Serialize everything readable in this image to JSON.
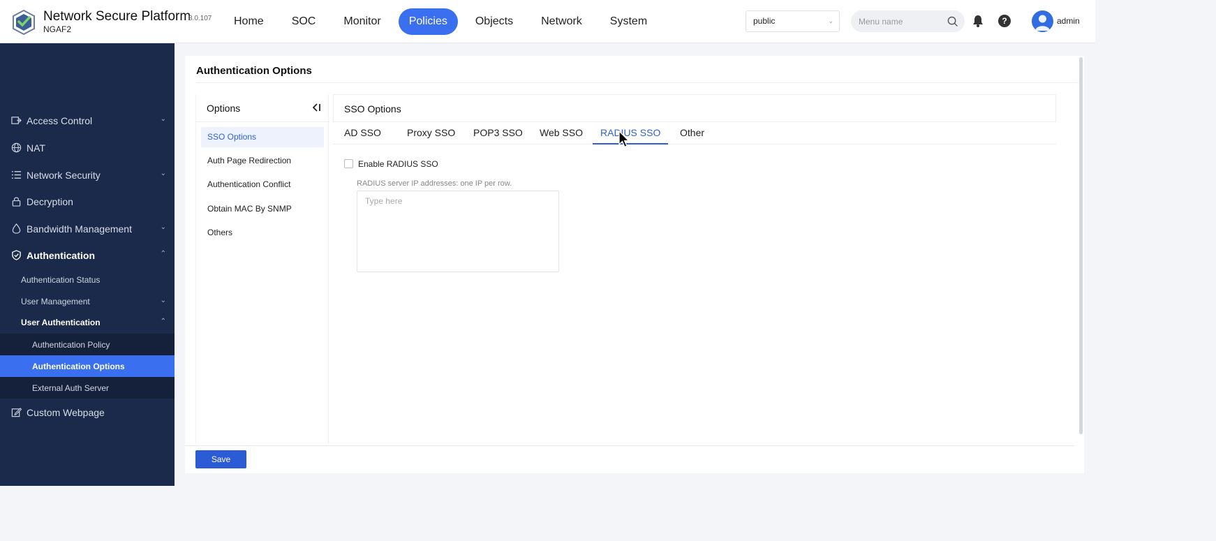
{
  "header": {
    "brand_title": "Network Secure Platform",
    "brand_sub": "NGAF2",
    "version": "8.0.107",
    "nav": [
      "Home",
      "SOC",
      "Monitor",
      "Policies",
      "Objects",
      "Network",
      "System"
    ],
    "active_nav": "Policies",
    "vsys_value": "public",
    "menu_search_placeholder": "Menu name",
    "user": "admin",
    "help_glyph": "?"
  },
  "sidebar": {
    "top_items": [
      {
        "label": "Access Control",
        "icon": "access-control-icon",
        "arrow": "down"
      },
      {
        "label": "NAT",
        "icon": "nat-globe-icon",
        "arrow": ""
      },
      {
        "label": "Network Security",
        "icon": "network-security-list-icon",
        "arrow": "down"
      },
      {
        "label": "Decryption",
        "icon": "lock-icon",
        "arrow": ""
      },
      {
        "label": "Bandwidth Management",
        "icon": "droplet-icon",
        "arrow": "down"
      },
      {
        "label": "Authentication",
        "icon": "shield-check-icon",
        "arrow": "up"
      }
    ],
    "sub_items": [
      {
        "label": "Authentication Status"
      },
      {
        "label": "User Management",
        "arrow": "down"
      },
      {
        "label": "User Authentication",
        "arrow": "up"
      }
    ],
    "level3_items": [
      {
        "label": "Authentication Policy"
      },
      {
        "label": "Authentication Options"
      },
      {
        "label": "External Auth Server"
      }
    ],
    "bottom_item": {
      "label": "Custom Webpage",
      "icon": "edit-icon"
    },
    "selected": "Authentication Options"
  },
  "main": {
    "page_title": "Authentication Options",
    "options_title": "Options",
    "options": [
      "SSO Options",
      "Auth Page Redirection",
      "Authentication Conflict",
      "Obtain MAC By SNMP",
      "Others"
    ],
    "active_option": "SSO Options",
    "sso_title": "SSO Options",
    "tabs": [
      "AD SSO",
      "Proxy SSO",
      "POP3 SSO",
      "Web SSO",
      "RADIUS SSO",
      "Other"
    ],
    "active_tab": "RADIUS SSO",
    "enable_label": "Enable RADIUS SSO",
    "enable_checked": false,
    "ip_hint": "RADIUS server IP addresses: one IP per row.",
    "ip_placeholder": "Type here",
    "ip_value": "",
    "save_label": "Save"
  },
  "colors": {
    "accent": "#3a6ff0",
    "sidebar_bg": "#1b2a4a",
    "save_button": "#2c5bd6",
    "active_tab_text": "#2f5fd8"
  }
}
